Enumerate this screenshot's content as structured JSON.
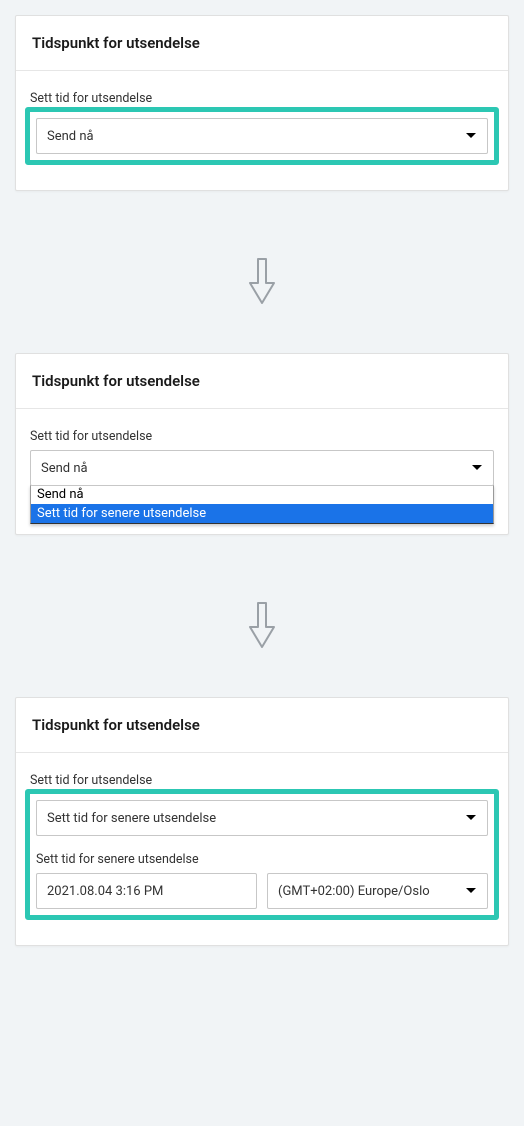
{
  "panel1": {
    "title": "Tidspunkt for utsendelse",
    "label": "Sett tid for utsendelse",
    "selected": "Send nå"
  },
  "panel2": {
    "title": "Tidspunkt for utsendelse",
    "label": "Sett tid for utsendelse",
    "selected": "Send nå",
    "options": {
      "opt0": "Send nå",
      "opt1": "Sett tid for senere utsendelse"
    }
  },
  "panel3": {
    "title": "Tidspunkt for utsendelse",
    "label": "Sett tid for utsendelse",
    "selected": "Sett tid for senere utsendelse",
    "schedule_label": "Sett tid for senere utsendelse",
    "datetime": "2021.08.04 3:16 PM",
    "timezone": "(GMT+02:00) Europe/Oslo"
  }
}
